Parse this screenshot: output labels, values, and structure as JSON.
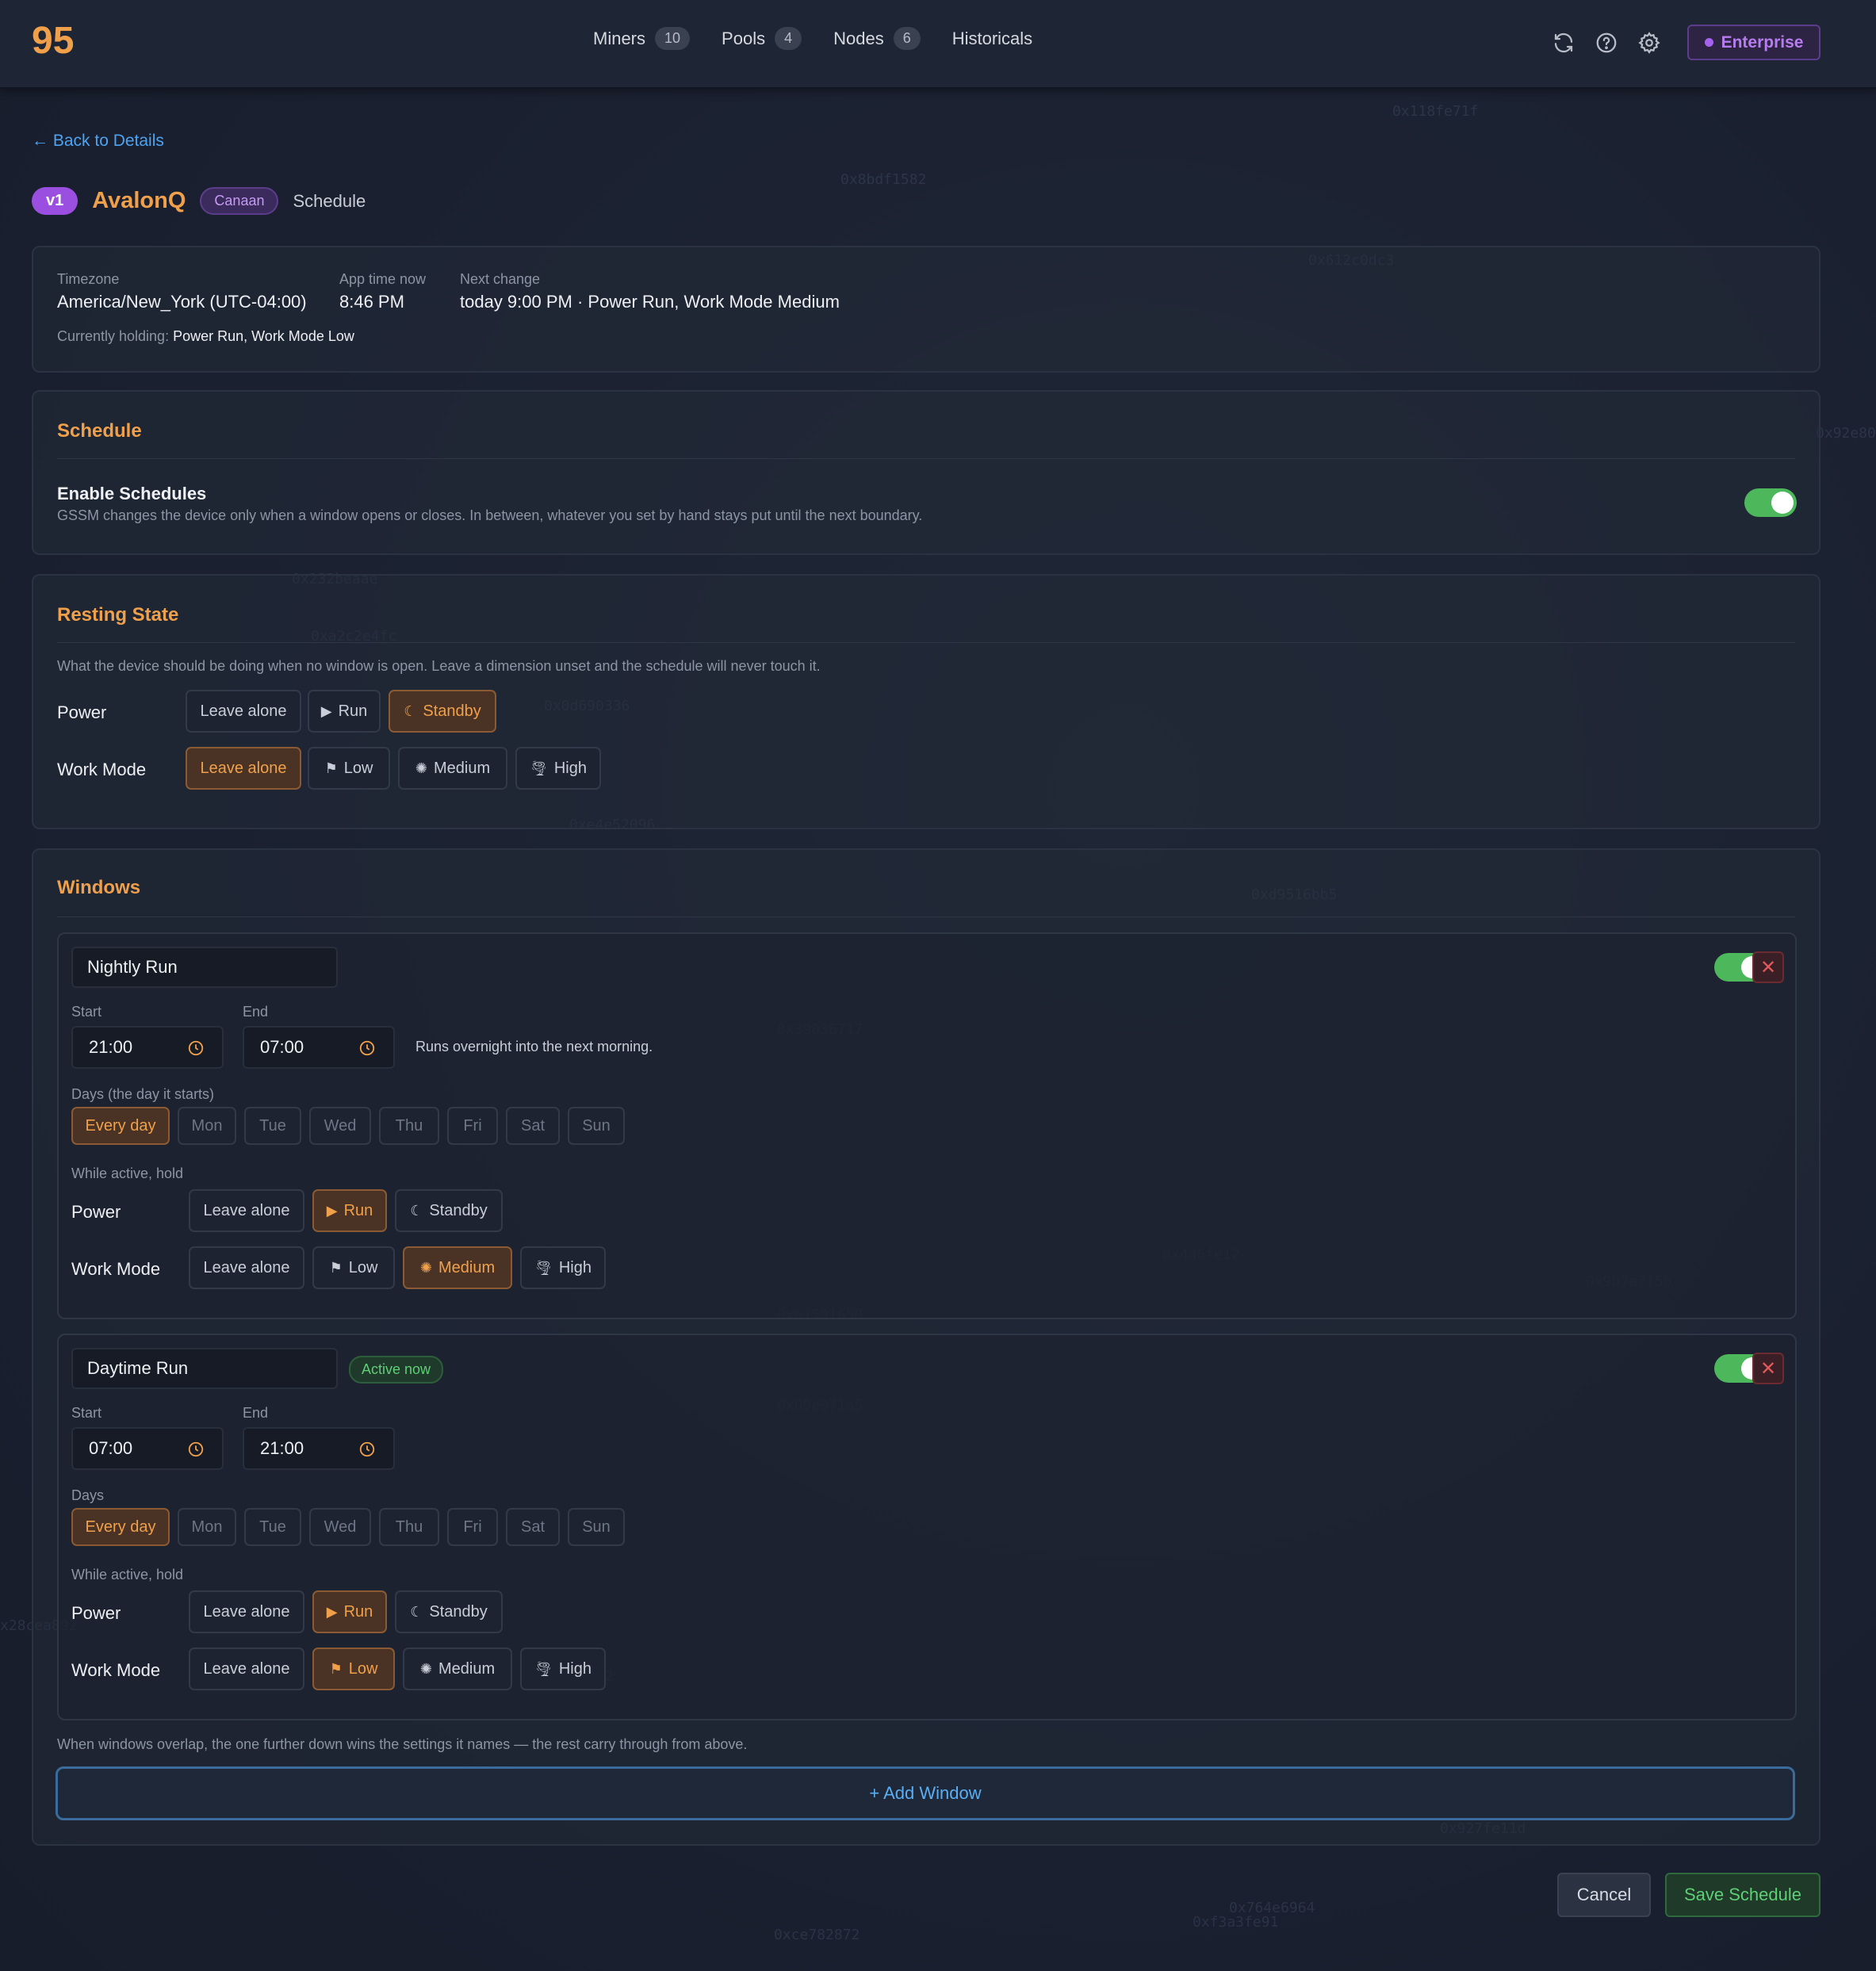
{
  "app": {
    "logo": "95",
    "plan": "Enterprise"
  },
  "nav": [
    {
      "label": "Miners",
      "count": "10"
    },
    {
      "label": "Pools",
      "count": "4"
    },
    {
      "label": "Nodes",
      "count": "6"
    },
    {
      "label": "Historicals",
      "count": ""
    }
  ],
  "back_link": "← Back to Details",
  "device": {
    "version": "v1",
    "model": "AvalonQ",
    "brand": "Canaan",
    "page": "Schedule"
  },
  "info": {
    "timezone_label": "Timezone",
    "timezone": "America/New_York (UTC-04:00)",
    "apptime_label": "App time now",
    "apptime": "8:46 PM",
    "next_label": "Next change",
    "next": "today 9:00 PM · Power Run, Work Mode Medium",
    "holding_label": "Currently holding:",
    "holding": "Power Run, Work Mode Low"
  },
  "schedule": {
    "title": "Schedule",
    "enable_label": "Enable Schedules",
    "enable_desc": "GSSM changes the device only when a window opens or closes. In between, whatever you set by hand stays put until the next boundary.",
    "enabled": true
  },
  "resting": {
    "title": "Resting State",
    "desc": "What the device should be doing when no window is open. Leave a dimension unset and the schedule will never touch it.",
    "power_label": "Power",
    "power_options": [
      "Leave alone",
      "Run",
      "Standby"
    ],
    "power_selected": "Standby",
    "workmode_label": "Work Mode",
    "workmode_options": [
      "Leave alone",
      "Low",
      "Medium",
      "High"
    ],
    "workmode_selected": "Leave alone"
  },
  "windows": {
    "title": "Windows",
    "items": [
      {
        "name": "Nightly Run",
        "start_label": "Start",
        "start": "21:00",
        "end_label": "End",
        "end": "07:00",
        "note": "Runs overnight into the next morning.",
        "days_label": "Days (the day it starts)",
        "days": [
          "Every day",
          "Mon",
          "Tue",
          "Wed",
          "Thu",
          "Fri",
          "Sat",
          "Sun"
        ],
        "days_selected": "Every day",
        "hold_label": "While active, hold",
        "power_label": "Power",
        "power_options": [
          "Leave alone",
          "Run",
          "Standby"
        ],
        "power_selected": "Run",
        "workmode_label": "Work Mode",
        "workmode_options": [
          "Leave alone",
          "Low",
          "Medium",
          "High"
        ],
        "workmode_selected": "Medium",
        "enabled": true
      },
      {
        "name": "Daytime Run",
        "badge": "Active now",
        "start_label": "Start",
        "start": "07:00",
        "end_label": "End",
        "end": "21:00",
        "days_label": "Days",
        "days": [
          "Every day",
          "Mon",
          "Tue",
          "Wed",
          "Thu",
          "Fri",
          "Sat",
          "Sun"
        ],
        "days_selected": "Every day",
        "hold_label": "While active, hold",
        "power_label": "Power",
        "power_options": [
          "Leave alone",
          "Run",
          "Standby"
        ],
        "power_selected": "Run",
        "workmode_label": "Work Mode",
        "workmode_options": [
          "Leave alone",
          "Low",
          "Medium",
          "High"
        ],
        "workmode_selected": "Low",
        "enabled": true
      }
    ],
    "overlap_note": "When windows overlap, the one further down wins the settings it names — the rest carry through from above.",
    "add_label": "+ Add Window"
  },
  "footer": {
    "cancel": "Cancel",
    "save": "Save Schedule"
  },
  "colors": {
    "accent": "#f0a04b",
    "link": "#4ea3f0",
    "success": "#4cb85b",
    "danger": "#e25a5a",
    "purple": "#9b4fe0"
  }
}
